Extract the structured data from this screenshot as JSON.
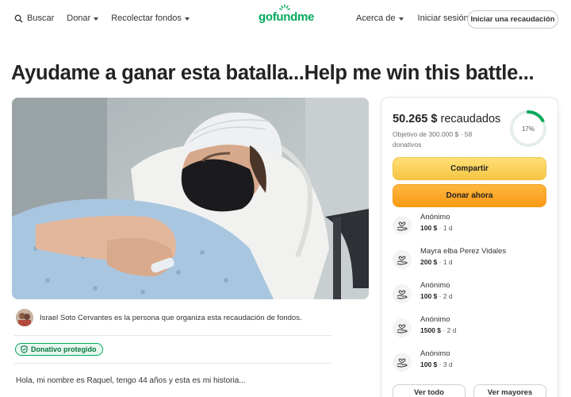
{
  "header": {
    "search_label": "Buscar",
    "donate_label": "Donar",
    "fundraise_label": "Recolectar fondos",
    "logo_text": "gofundme",
    "about_label": "Acerca de",
    "signin_label": "Iniciar sesión",
    "start_label": "Iniciar una recaudación",
    "brand_color": "#02a95c"
  },
  "campaign": {
    "title": "Ayudame a ganar esta batalla...Help me win this battle...",
    "organizer_text": "Israel Soto Cervantes es la persona que organiza esta recaudación de fondos.",
    "protected_label": "Donativo protegido",
    "story_start": "Hola, mi nombre es Raquel, tengo 44 años y esta es mi historia..."
  },
  "card": {
    "raised_amount": "50.265 $",
    "raised_label": "recaudados",
    "goal_text": "Objetivo de 300.000 $",
    "donations_count_text": "58 donativos",
    "progress_label": "17%",
    "progress_fraction": 0.17,
    "share_label": "Compartir",
    "donate_now_label": "Donar ahora",
    "donations": [
      {
        "name": "Anónimo",
        "amount": "100 $",
        "time": "1 d"
      },
      {
        "name": "Mayra elba Perez Vidales",
        "amount": "200 $",
        "time": "1 d"
      },
      {
        "name": "Anónimo",
        "amount": "100 $",
        "time": "2 d"
      },
      {
        "name": "Anónimo",
        "amount": "1500 $",
        "time": "2 d"
      },
      {
        "name": "Anónimo",
        "amount": "100 $",
        "time": "3 d"
      }
    ],
    "see_all_label": "Ver todo",
    "see_top_label": "Ver mayores"
  }
}
